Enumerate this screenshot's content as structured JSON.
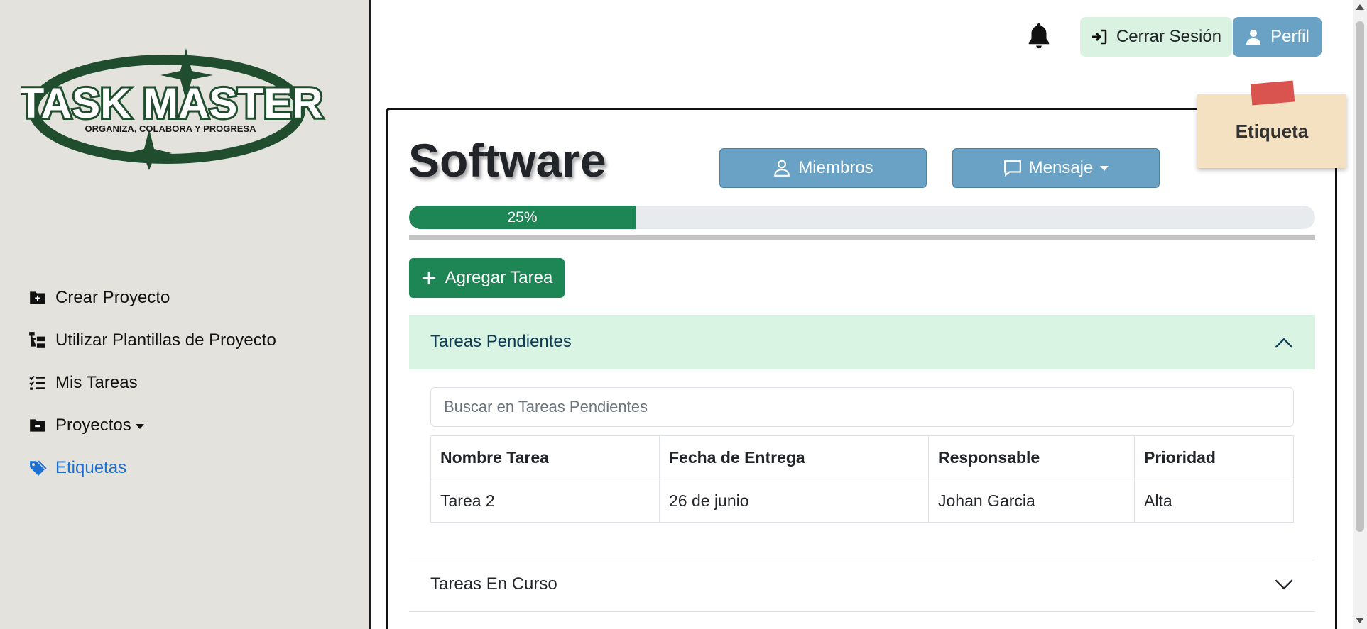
{
  "logo": {
    "title": "TASK MASTER",
    "tagline": "ORGANIZA, COLABORA Y PROGRESA"
  },
  "sidebar": {
    "items": [
      {
        "label": "Crear Proyecto",
        "icon": "folder-plus-icon"
      },
      {
        "label": "Utilizar Plantillas de Proyecto",
        "icon": "folder-tree-icon"
      },
      {
        "label": "Mis Tareas",
        "icon": "list-check-icon"
      },
      {
        "label": "Proyectos",
        "icon": "folder-minus-icon"
      },
      {
        "label": "Etiquetas",
        "icon": "tags-icon"
      }
    ]
  },
  "header": {
    "logout_label": "Cerrar Sesión",
    "profile_label": "Perfil"
  },
  "sticky": {
    "label": "Etiqueta"
  },
  "project": {
    "title": "Software",
    "members_label": "Miembros",
    "message_label": "Mensaje",
    "progress_percent": 25,
    "progress_label": "25%",
    "add_task_label": "Agregar Tarea"
  },
  "pending": {
    "header": "Tareas Pendientes",
    "search_placeholder": "Buscar en Tareas Pendientes",
    "columns": [
      "Nombre Tarea",
      "Fecha de Entrega",
      "Responsable",
      "Prioridad"
    ],
    "rows": [
      [
        "Tarea 2",
        "26 de junio",
        "Johan Garcia",
        "Alta"
      ]
    ]
  },
  "in_progress": {
    "header": "Tareas En Curso"
  },
  "colors": {
    "sidebar_bg": "#e3e2dd",
    "accent_blue": "#6aa2c6",
    "success_green": "#1e8655",
    "pending_bg": "#d9f4e2",
    "active_link": "#1f6fd1"
  }
}
